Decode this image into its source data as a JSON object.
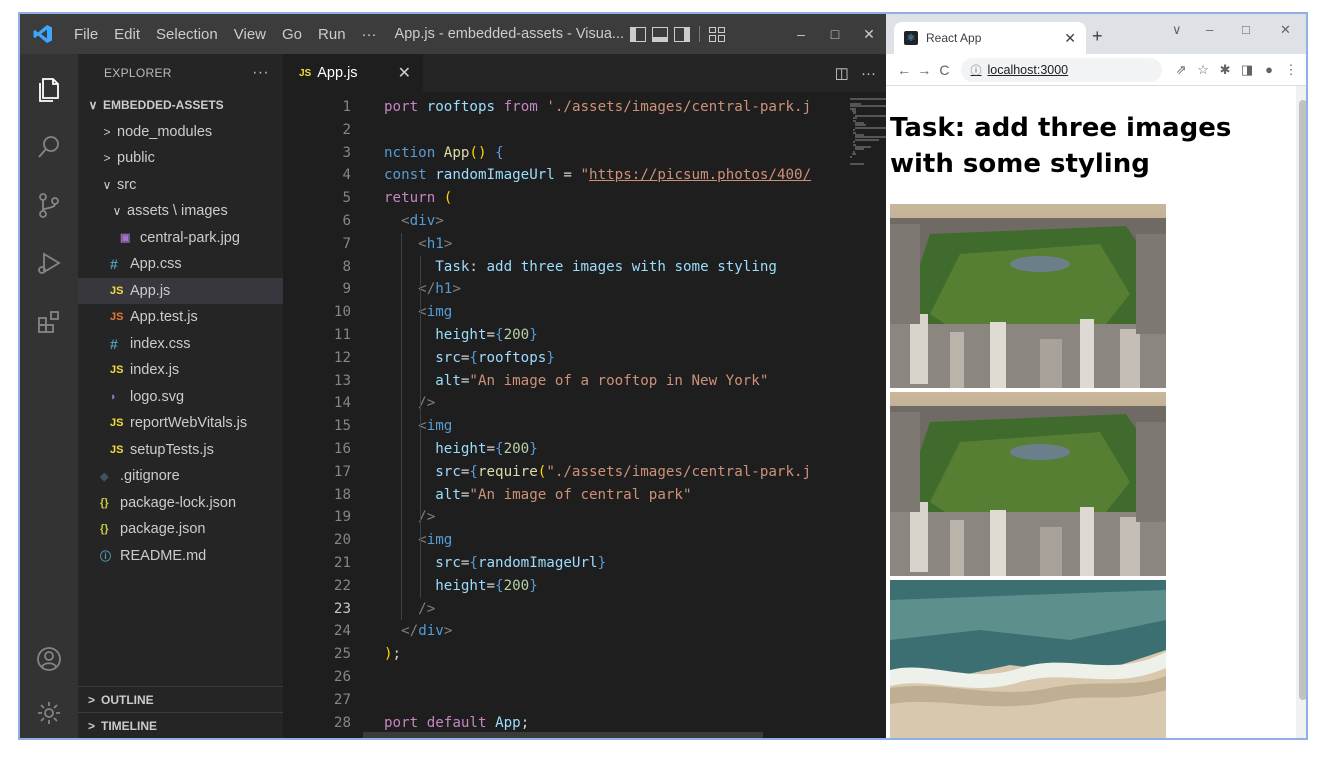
{
  "vscode": {
    "menu": [
      "File",
      "Edit",
      "Selection",
      "View",
      "Go",
      "Run",
      "···"
    ],
    "window_title": "App.js - embedded-assets - Visua...",
    "win_controls": [
      "–",
      "□",
      "✕"
    ],
    "explorer": {
      "header": "EXPLORER",
      "more": "···",
      "root": "EMBEDDED-ASSETS",
      "items": [
        {
          "label": "node_modules",
          "chev": ">",
          "icon": "",
          "indent": 0
        },
        {
          "label": "public",
          "chev": ">",
          "icon": "",
          "indent": 0
        },
        {
          "label": "src",
          "chev": "∨",
          "icon": "",
          "indent": 0
        },
        {
          "label": "assets \\ images",
          "chev": "∨",
          "icon": "",
          "indent": 1
        },
        {
          "label": "central-park.jpg",
          "chev": "",
          "icon": "img",
          "indent": 2
        },
        {
          "label": "App.css",
          "chev": "",
          "icon": "css",
          "indent": 1
        },
        {
          "label": "App.js",
          "chev": "",
          "icon": "js",
          "indent": 1
        },
        {
          "label": "App.test.js",
          "chev": "",
          "icon": "jsr",
          "indent": 1
        },
        {
          "label": "index.css",
          "chev": "",
          "icon": "css",
          "indent": 1
        },
        {
          "label": "index.js",
          "chev": "",
          "icon": "js",
          "indent": 1
        },
        {
          "label": "logo.svg",
          "chev": "",
          "icon": "svg",
          "indent": 1
        },
        {
          "label": "reportWebVitals.js",
          "chev": "",
          "icon": "js",
          "indent": 1
        },
        {
          "label": "setupTests.js",
          "chev": "",
          "icon": "js",
          "indent": 1
        },
        {
          "label": ".gitignore",
          "chev": "",
          "icon": "git",
          "indent": 0
        },
        {
          "label": "package-lock.json",
          "chev": "",
          "icon": "json",
          "indent": 0
        },
        {
          "label": "package.json",
          "chev": "",
          "icon": "json",
          "indent": 0
        },
        {
          "label": "README.md",
          "chev": "",
          "icon": "info",
          "indent": 0
        }
      ],
      "outline": "OUTLINE",
      "timeline": "TIMELINE"
    },
    "tab": {
      "badge": "JS",
      "label": "App.js",
      "close": "✕"
    },
    "current_line": 23,
    "code_lines": [
      "port rooftops from './assets/images/central-park.j",
      "",
      "nction App() {",
      "const randomImageUrl = \"https://picsum.photos/400/",
      "return (",
      "  <div>",
      "    <h1>",
      "      Task: add three images with some styling",
      "    </h1>",
      "    <img",
      "      height={200}",
      "      src={rooftops}",
      "      alt=\"An image of a rooftop in New York\"",
      "    />",
      "    <img",
      "      height={200}",
      "      src={require(\"./assets/images/central-park.j",
      "      alt=\"An image of central park\"",
      "    />",
      "    <img",
      "      src={randomImageUrl}",
      "      height={200}",
      "    />",
      "  </div>",
      ");",
      "",
      "",
      "port default App;"
    ]
  },
  "chrome": {
    "tab_title": "React App",
    "tab_close": "✕",
    "new_tab": "+",
    "win_controls": [
      "∨",
      "–",
      "□",
      "✕"
    ],
    "url": "localhost:3000",
    "page": {
      "heading": "Task: add three images with some styling",
      "images": [
        {
          "alt": "An image of a rooftop in New York",
          "kind": "park"
        },
        {
          "alt": "An image of central park",
          "kind": "park"
        },
        {
          "alt": "",
          "kind": "beach"
        }
      ]
    }
  },
  "colors": {
    "vscode_bg": "#1e1e1e",
    "titlebar": "#3c3c3c",
    "activitybar": "#333333",
    "sidebar": "#252526",
    "chrome_tabstrip": "#dee1e6"
  }
}
